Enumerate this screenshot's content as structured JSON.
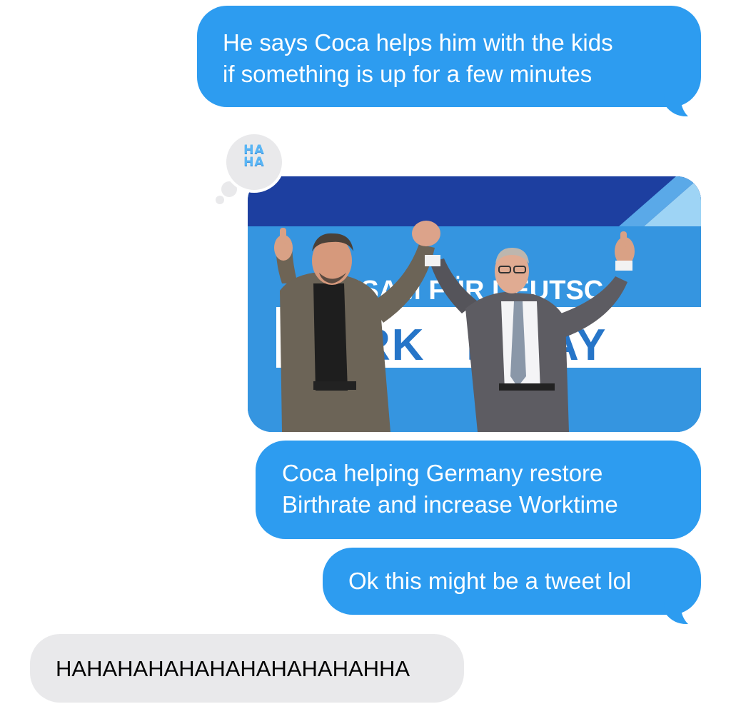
{
  "thread": {
    "messages": [
      {
        "direction": "outgoing",
        "text_line1": "He says Coca helps him with the kids",
        "text_line2": "if something is up for a few minutes"
      },
      {
        "direction": "outgoing",
        "type": "image",
        "image_description_icon": "photo-two-men-raising-joined-hands",
        "image_banner_line1": "EINSAM FÜR DEUTSC",
        "image_banner_line2": "RK   R BAY",
        "reaction": {
          "icon": "haha-reaction-icon",
          "label": "HA\nHA"
        }
      },
      {
        "direction": "outgoing",
        "text_line1": "Coca helping Germany restore",
        "text_line2": "Birthrate and increase Worktime"
      },
      {
        "direction": "outgoing",
        "text_line1": "Ok this might be a tweet lol"
      },
      {
        "direction": "incoming",
        "text_line1": "HAHAHAHAHAHAHAHAHAHAHHA"
      }
    ]
  },
  "colors": {
    "outgoing_bubble": "#2d9cf0",
    "incoming_bubble": "#e9e9eb",
    "outgoing_text": "#ffffff",
    "incoming_text": "#000000"
  }
}
